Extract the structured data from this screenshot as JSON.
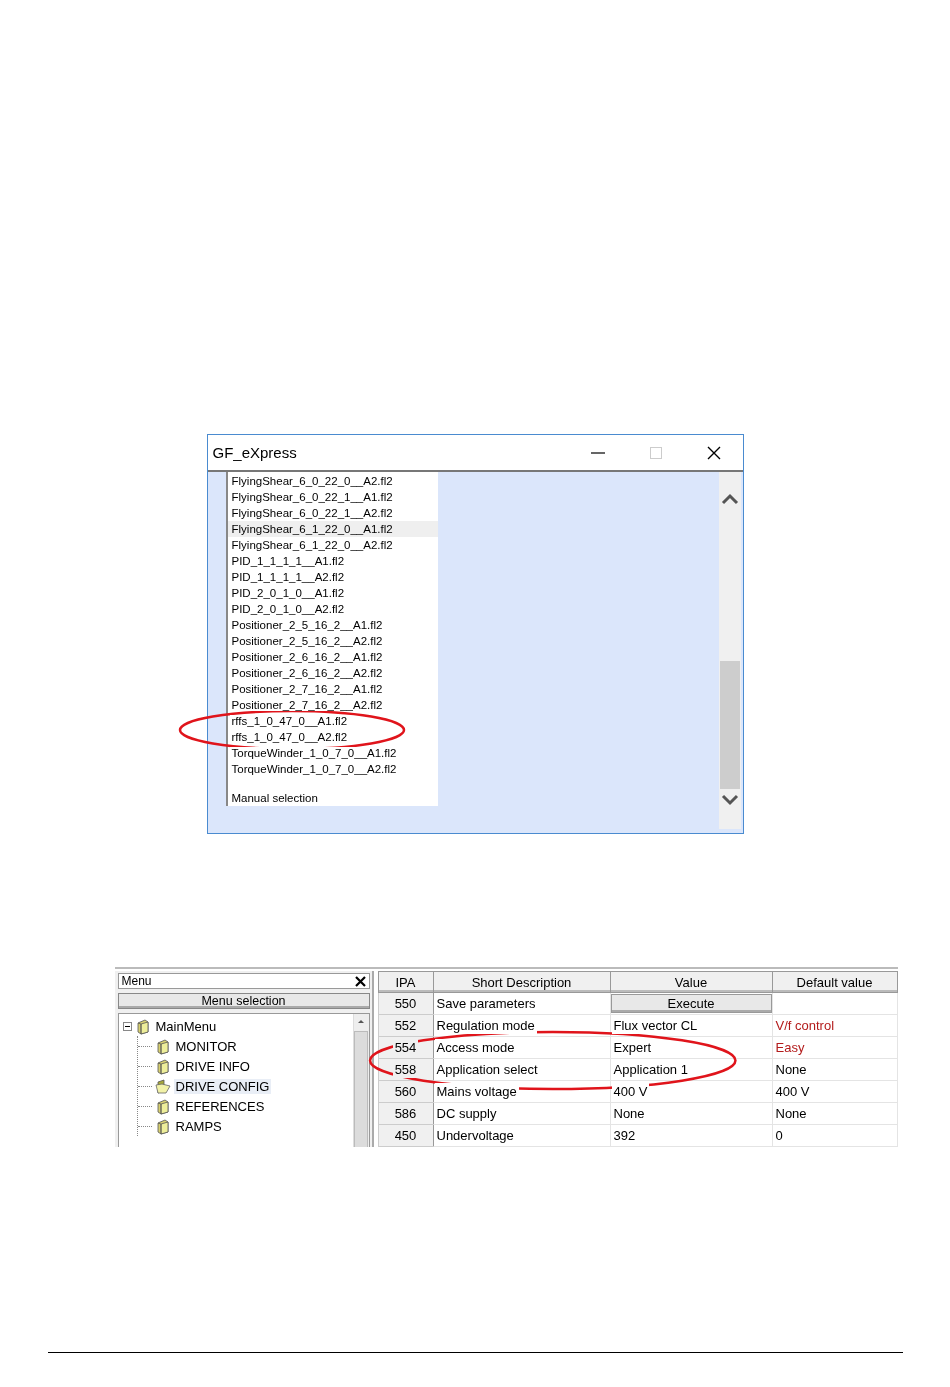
{
  "file_dialog": {
    "title": "GF_eXpress",
    "files": [
      {
        "kind": "file",
        "name": "FlyingShear_6_0_22_0__A2.fl2",
        "selected": false
      },
      {
        "kind": "file",
        "name": "FlyingShear_6_0_22_1__A1.fl2",
        "selected": false
      },
      {
        "kind": "file",
        "name": "FlyingShear_6_0_22_1__A2.fl2",
        "selected": false
      },
      {
        "kind": "file",
        "name": "FlyingShear_6_1_22_0__A1.fl2",
        "selected": true
      },
      {
        "kind": "file",
        "name": "FlyingShear_6_1_22_0__A2.fl2",
        "selected": false
      },
      {
        "kind": "file",
        "name": "PID_1_1_1_1__A1.fl2",
        "selected": false
      },
      {
        "kind": "file",
        "name": "PID_1_1_1_1__A2.fl2",
        "selected": false
      },
      {
        "kind": "file",
        "name": "PID_2_0_1_0__A1.fl2",
        "selected": false
      },
      {
        "kind": "file",
        "name": "PID_2_0_1_0__A2.fl2",
        "selected": false
      },
      {
        "kind": "file",
        "name": "Positioner_2_5_16_2__A1.fl2",
        "selected": false
      },
      {
        "kind": "file",
        "name": "Positioner_2_5_16_2__A2.fl2",
        "selected": false
      },
      {
        "kind": "file",
        "name": "Positioner_2_6_16_2__A1.fl2",
        "selected": false
      },
      {
        "kind": "file",
        "name": "Positioner_2_6_16_2__A2.fl2",
        "selected": false
      },
      {
        "kind": "file",
        "name": "Positioner_2_7_16_2__A1.fl2",
        "selected": false
      },
      {
        "kind": "file",
        "name": "Positioner_2_7_16_2__A2.fl2",
        "selected": false
      },
      {
        "kind": "circled_group",
        "items": [
          {
            "name": "rffs_1_0_47_0__A1.fl2",
            "selected": false
          },
          {
            "name": "rffs_1_0_47_0__A2.fl2",
            "selected": false
          }
        ]
      },
      {
        "kind": "file",
        "name": "TorqueWinder_1_0_7_0__A1.fl2",
        "selected": false
      },
      {
        "kind": "file",
        "name": "TorqueWinder_1_0_7_0__A2.fl2",
        "selected": false
      }
    ],
    "manual_entry": "Manual selection"
  },
  "parameter_editor": {
    "menu_panel": {
      "title": "Menu",
      "header_button": "Menu selection",
      "tree": [
        {
          "label": "MainMenu",
          "expanded": true,
          "selected": false,
          "children": [
            {
              "label": "MONITOR",
              "selected": false
            },
            {
              "label": "DRIVE INFO",
              "selected": false
            },
            {
              "label": "DRIVE CONFIG",
              "selected": true
            },
            {
              "label": "REFERENCES",
              "selected": false
            },
            {
              "label": "RAMPS",
              "selected": false
            }
          ]
        }
      ]
    },
    "table": {
      "columns": [
        "IPA",
        "Short Description",
        "Value",
        "Default value"
      ],
      "rows": [
        {
          "kind": "button",
          "ipa": "550",
          "description": "Save parameters",
          "value": "Execute"
        },
        {
          "kind": "text",
          "ipa": "552",
          "description": "Regulation mode",
          "value": "Flux vector CL",
          "default": "V/f control",
          "modified": true
        },
        {
          "kind": "circled_group",
          "rows": [
            {
              "ipa": "554",
              "description": "Access mode",
              "value": "Expert",
              "default": "Easy",
              "modified": true
            },
            {
              "ipa": "558",
              "description": "Application select",
              "value": "Application 1",
              "default": "None",
              "modified": false
            }
          ]
        },
        {
          "kind": "text",
          "ipa": "560",
          "description": "Mains voltage",
          "value": "400 V",
          "default": "400 V",
          "modified": false
        },
        {
          "kind": "text",
          "ipa": "586",
          "description": "DC supply",
          "value": "None",
          "default": "None",
          "modified": false
        },
        {
          "kind": "text",
          "ipa": "450",
          "description": "Undervoltage",
          "value": "392",
          "default": "0",
          "modified": false
        }
      ]
    }
  }
}
